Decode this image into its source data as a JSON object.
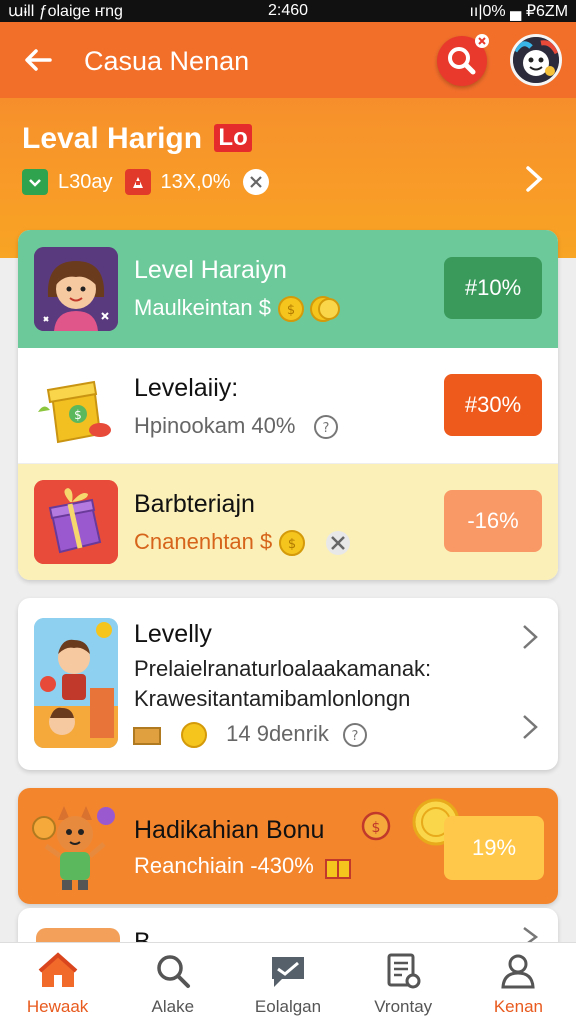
{
  "status_bar": {
    "left": "աɨll ƒolaige  ҥng",
    "time": "2:460",
    "right": "ıı|0% ▄ ₽6ZM"
  },
  "app_bar": {
    "title": "Casua Nenan"
  },
  "level_header": {
    "title": "Leval Harign",
    "chip": "Lo",
    "stat1": "L30ay",
    "stat2": "13X,0%"
  },
  "rows": [
    {
      "title": "Level Haraiyn",
      "subtitle": "Maulkeintan",
      "currency": "$",
      "pill": "#10%"
    },
    {
      "title": "Levelaiiy:",
      "subtitle": "Hpinookam 40%",
      "pill": "#30%"
    },
    {
      "title": "Barbteriajn",
      "subtitle": "Cnanenhtan",
      "currency": "$",
      "pill": "-16%"
    }
  ],
  "promo": {
    "title": "Levelly",
    "line1": "Prelaielranaturloalaakamanak:",
    "line2": "Krawesitantamibamlonlongn",
    "meta": "14 9denrik"
  },
  "bonus": {
    "title": "Hadikahian Bonu",
    "subtitle": "Reanchiain -430%",
    "pill": "19%"
  },
  "partial_row": {
    "title": "B..."
  },
  "nav": [
    {
      "label": "Hewaak",
      "icon": "home-icon",
      "active": true
    },
    {
      "label": "Alake",
      "icon": "search-icon",
      "active": false
    },
    {
      "label": "Eolalgan",
      "icon": "chat-icon",
      "active": false
    },
    {
      "label": "Vrontay",
      "icon": "receipt-icon",
      "active": false
    },
    {
      "label": "Kenan",
      "icon": "profile-icon",
      "active": true
    }
  ],
  "colors": {
    "header": "#f47a2a",
    "row1_bg": "#6cc99a",
    "row1_pill": "#3a9a5c",
    "row2_pill": "#ee5a1c",
    "row3_bg": "#fbf0b8",
    "row3_pill": "#f99966",
    "bonus_bg": "#f3852d",
    "bonus_pill": "#ffc84a"
  }
}
